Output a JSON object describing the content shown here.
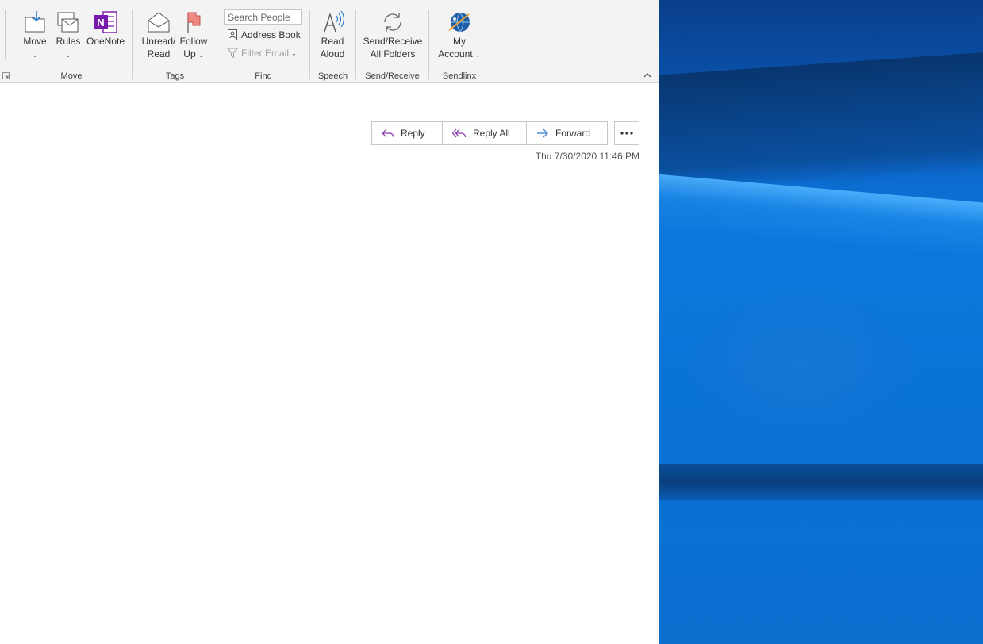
{
  "ribbon": {
    "move_group": {
      "label": "Move",
      "move": "Move",
      "rules": "Rules",
      "onenote": "OneNote"
    },
    "tags_group": {
      "label": "Tags",
      "unread_read_line1": "Unread/",
      "unread_read_line2": "Read",
      "follow_up_line1": "Follow",
      "follow_up_line2": "Up"
    },
    "find_group": {
      "label": "Find",
      "search_placeholder": "Search People",
      "address_book": "Address Book",
      "filter_email": "Filter Email"
    },
    "speech_group": {
      "label": "Speech",
      "read_aloud_line1": "Read",
      "read_aloud_line2": "Aloud"
    },
    "sendreceive_group": {
      "label": "Send/Receive",
      "line1": "Send/Receive",
      "line2": "All Folders"
    },
    "sendlinx_group": {
      "label": "Sendlinx",
      "line1": "My",
      "line2": "Account"
    }
  },
  "message": {
    "reply": "Reply",
    "reply_all": "Reply All",
    "forward": "Forward",
    "timestamp": "Thu 7/30/2020 11:46 PM"
  },
  "colors": {
    "accent": "#2b579a",
    "onenote": "#7719aa",
    "flag": "#e8706a"
  }
}
